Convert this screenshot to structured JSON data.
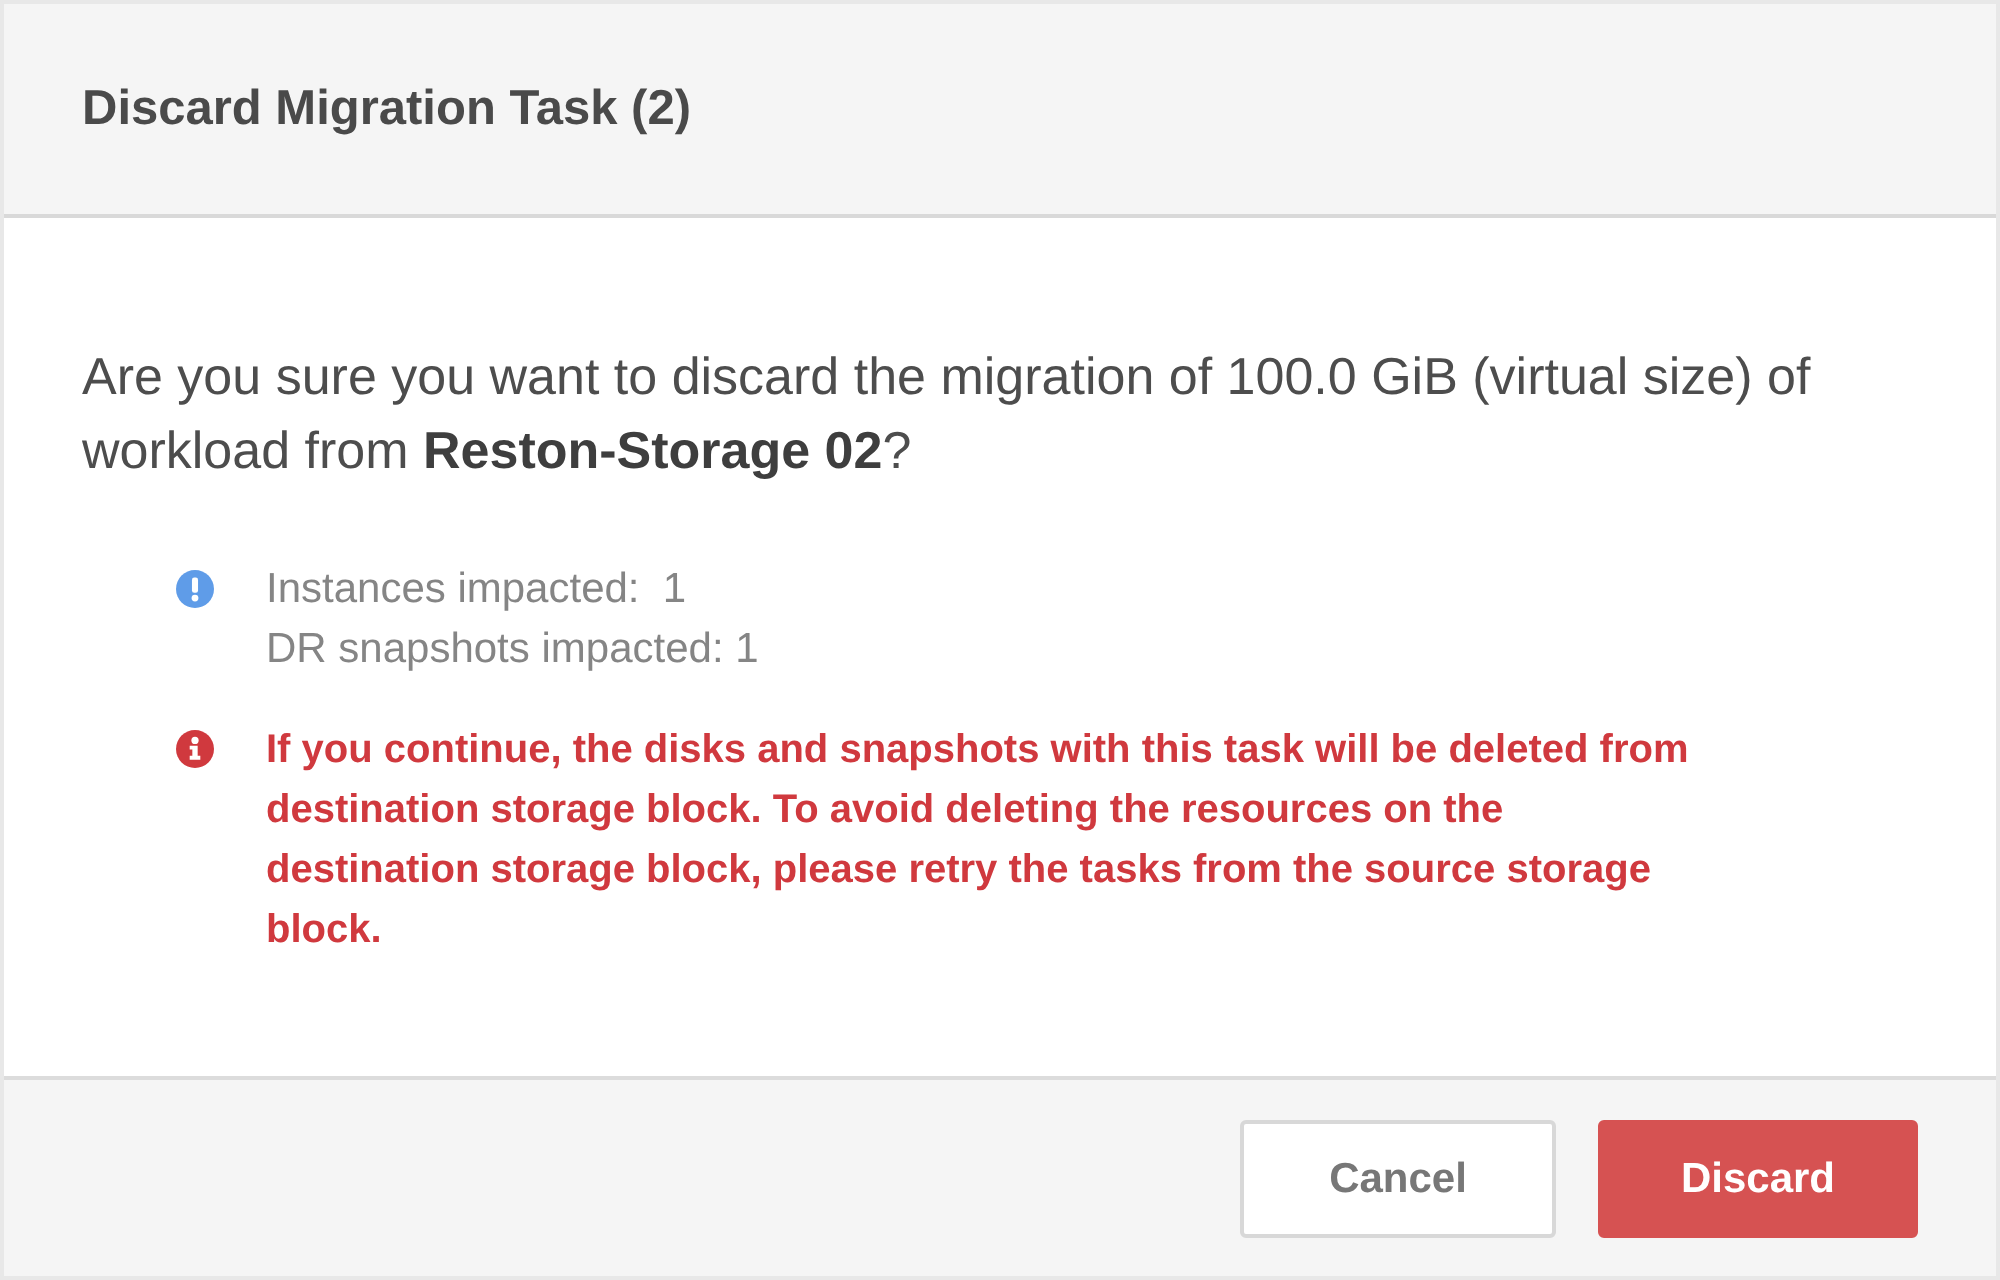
{
  "dialog": {
    "title": "Discard Migration Task (2)",
    "message": "Are you sure you want to discard the migration of 100.0 GiB (virtual size) of workload from **Reston-Storage 02**?",
    "notices": [
      {
        "kind": "info",
        "lines": [
          "Instances impacted:  1",
          "DR snapshots impacted: 1"
        ]
      },
      {
        "kind": "error",
        "lines": [
          "If you continue, the disks and snapshots with this task will be deleted from destination storage block. To avoid deleting the resources on the destination storage block, please retry the tasks from the source storage block."
        ]
      }
    ],
    "buttons": [
      {
        "label": "Cancel",
        "kind": "secondary"
      },
      {
        "label": "Discard",
        "kind": "danger"
      }
    ]
  }
}
